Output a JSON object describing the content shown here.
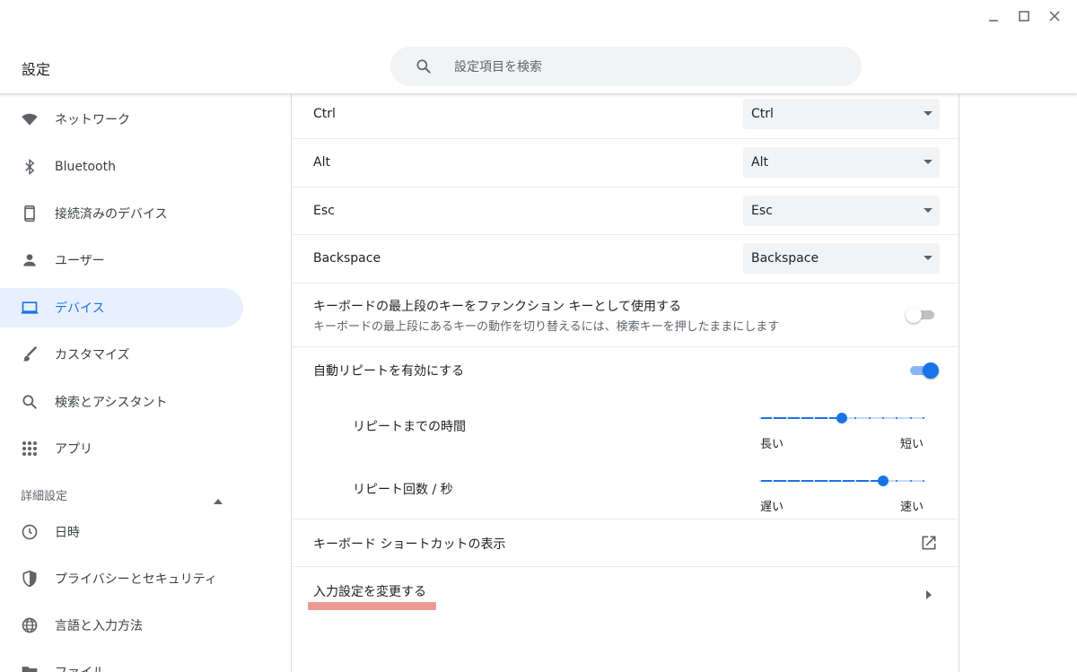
{
  "window": {
    "title": "設定"
  },
  "search": {
    "placeholder": "設定項目を検索"
  },
  "sidebar": {
    "items": [
      {
        "label": "ネットワーク",
        "icon": "wifi-icon"
      },
      {
        "label": "Bluetooth",
        "icon": "bluetooth-icon"
      },
      {
        "label": "接続済みのデバイス",
        "icon": "phone-icon"
      },
      {
        "label": "ユーザー",
        "icon": "person-icon"
      },
      {
        "label": "デバイス",
        "icon": "laptop-icon",
        "active": true
      },
      {
        "label": "カスタマイズ",
        "icon": "brush-icon"
      },
      {
        "label": "検索とアシスタント",
        "icon": "search-icon"
      },
      {
        "label": "アプリ",
        "icon": "apps-grid-icon"
      }
    ],
    "advanced_header": "詳細設定",
    "advanced_items": [
      {
        "label": "日時",
        "icon": "clock-icon"
      },
      {
        "label": "プライバシーとセキュリティ",
        "icon": "shield-icon"
      },
      {
        "label": "言語と入力方法",
        "icon": "globe-icon"
      },
      {
        "label": "ファイル",
        "icon": "folder-icon"
      }
    ]
  },
  "keymap": [
    {
      "label": "Ctrl",
      "value": "Ctrl"
    },
    {
      "label": "Alt",
      "value": "Alt"
    },
    {
      "label": "Esc",
      "value": "Esc"
    },
    {
      "label": "Backspace",
      "value": "Backspace"
    }
  ],
  "function_keys": {
    "title": "キーボードの最上段のキーをファンクション キーとして使用する",
    "description": "キーボードの最上段にあるキーの動作を切り替えるには、検索キーを押したままにします",
    "enabled": false
  },
  "auto_repeat": {
    "label": "自動リピートを有効にする",
    "enabled": true,
    "delay": {
      "label": "リピートまでの時間",
      "min_label": "長い",
      "max_label": "短い",
      "value": 0.5
    },
    "rate": {
      "label": "リピート回数 / 秒",
      "min_label": "遅い",
      "max_label": "速い",
      "value": 0.75
    }
  },
  "shortcuts": {
    "label": "キーボード ショートカットの表示"
  },
  "input_settings": {
    "label": "入力設定を変更する"
  },
  "colors": {
    "accent": "#1a73e8",
    "active_bg": "#e8f0fe",
    "highlight_mark": "#ef9a94"
  }
}
